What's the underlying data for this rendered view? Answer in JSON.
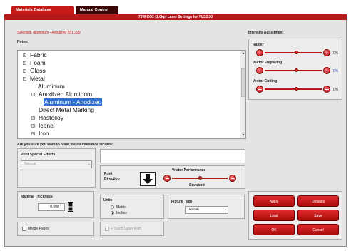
{
  "tabs": [
    {
      "label": "Materials Database"
    },
    {
      "label": "Manual Control"
    }
  ],
  "window": {
    "title": "75W CO2 (1.0kp) Laser Settings for VLS2.30"
  },
  "selected_text": "Selected: Aluminum - Anodized 251 299",
  "notes_label": "Notes:",
  "tree": [
    {
      "label": "Fabric",
      "expander": "+"
    },
    {
      "label": "Foam",
      "expander": "+"
    },
    {
      "label": "Glass",
      "expander": "+"
    },
    {
      "label": "Metal",
      "expander": "-"
    },
    {
      "label": "Aluminum",
      "expander": ""
    },
    {
      "label": "Anodized Aluminum",
      "expander": "-"
    },
    {
      "label": "Aluminum - Anodized",
      "expander": "",
      "selected": true
    },
    {
      "label": "Direct Metal Marking",
      "expander": ""
    },
    {
      "label": "Hastelloy",
      "expander": "+"
    },
    {
      "label": "Iconel",
      "expander": "+"
    },
    {
      "label": "Iron",
      "expander": "+"
    }
  ],
  "question": "Are you sure you want to reset the maintenance record?",
  "print_special_effects": {
    "label": "Print Special Effects",
    "value": "Normal"
  },
  "print_direction_label": "Print\nDirection",
  "vector_performance": {
    "label": "Vector Performance",
    "value": "Standard",
    "level": 0.5
  },
  "material_thickness": {
    "label": "Material Thickness",
    "value": "0.000 \""
  },
  "units": {
    "label": "Units",
    "options": [
      "Metric",
      "Inches"
    ],
    "selected": "Inches"
  },
  "fixture_type": {
    "label": "Fixture Type",
    "value": "NONE"
  },
  "merge_pages_label": "Merge Pages",
  "vector_pass_label": "+ Touch Laser Path",
  "intensity": {
    "title": "Intensity Adjustment",
    "sliders": [
      {
        "label": "Raster",
        "value": "0%",
        "value_color": "#222222",
        "level": 0.55
      },
      {
        "label": "Vector Engraving",
        "value": "0%",
        "value_color": "#2a3fbf",
        "level": 0.55
      },
      {
        "label": "Vector Cutting",
        "value": "0%",
        "value_color": "#222222",
        "level": 0.55
      }
    ]
  },
  "buttons": {
    "apply": "Apply",
    "defaults": "Defaults",
    "load": "Load",
    "save": "Save",
    "ok": "OK",
    "cancel": "Cancel"
  },
  "colors": {
    "accent": "#c61a1a",
    "dark_tab": "#3a0505",
    "selection": "#2f6fd1"
  }
}
